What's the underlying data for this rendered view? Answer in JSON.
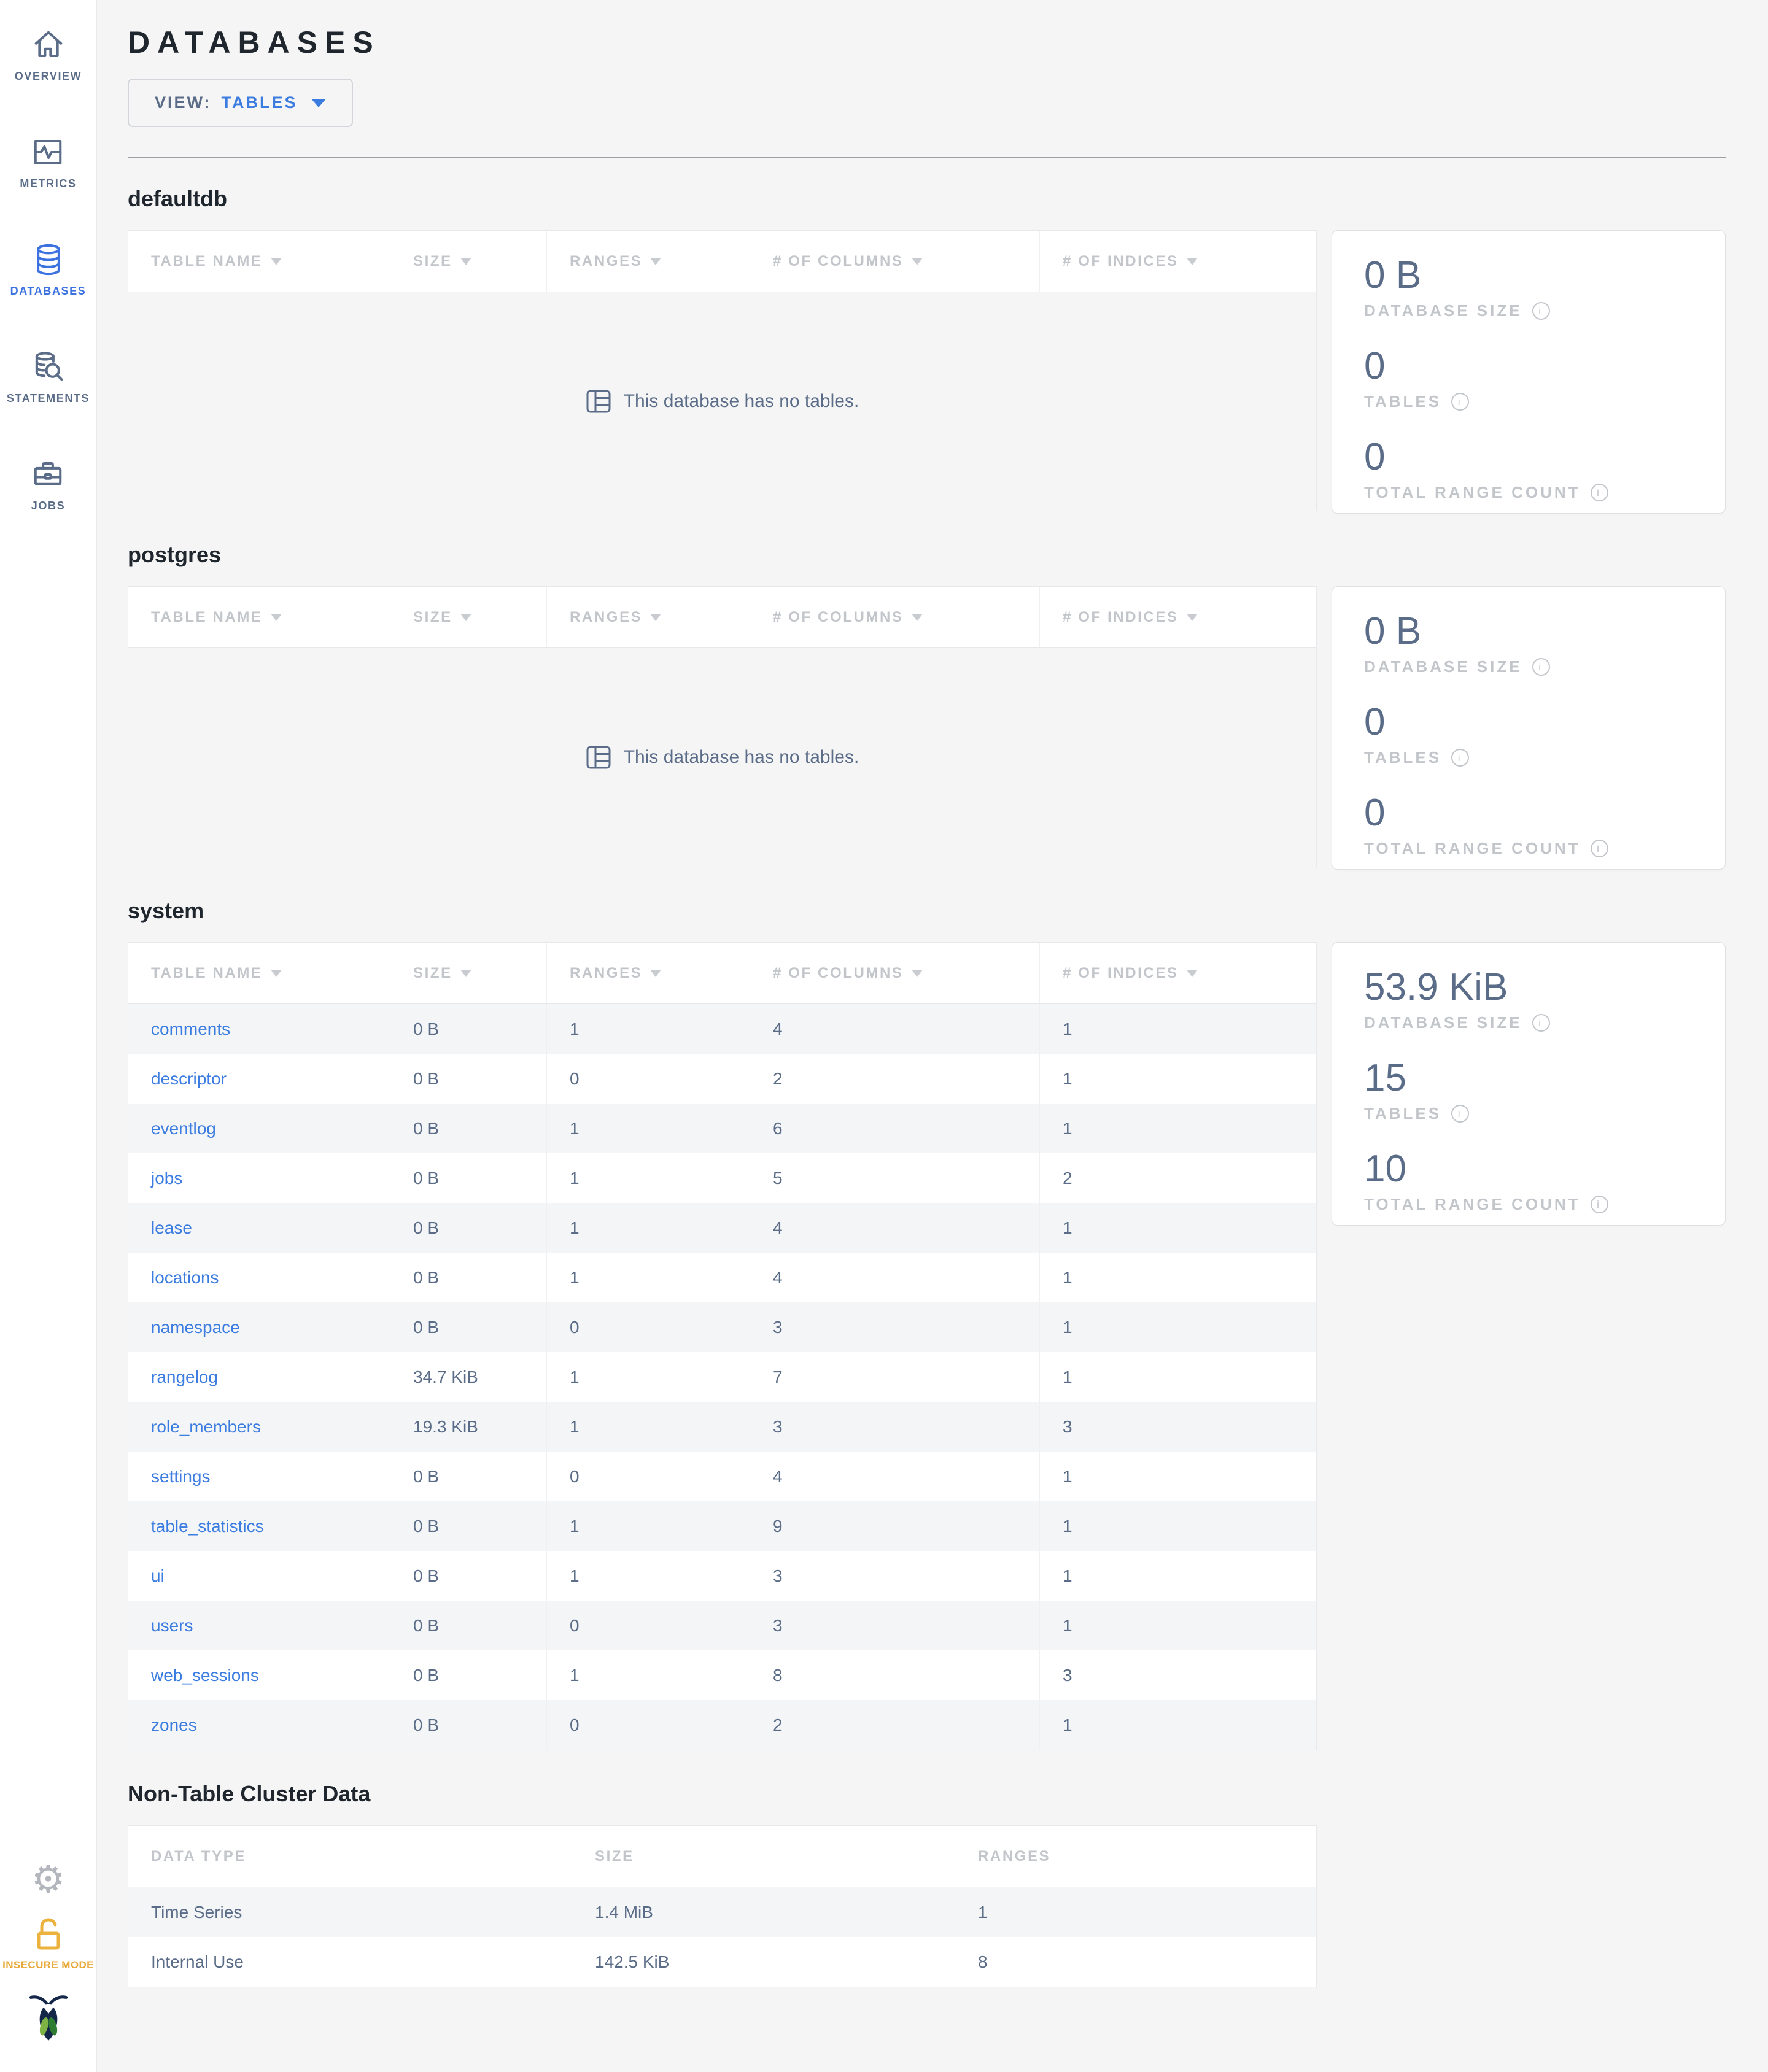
{
  "colors": {
    "page_bg": "#f5f5f5",
    "sidebar_bg": "#ffffff",
    "accent_blue": "#3b7ce0",
    "sidebar_active_blue": "#3b72e0",
    "slate_text": "#5a6c87",
    "muted_label": "#c2c5ca",
    "heading_text": "#20262e",
    "warning_yellow": "#e8a93a",
    "row_stripe": "#f4f5f7"
  },
  "sidebar": {
    "items": [
      {
        "label": "OVERVIEW",
        "icon": "home-icon",
        "active": false
      },
      {
        "label": "METRICS",
        "icon": "metrics-icon",
        "active": false
      },
      {
        "label": "DATABASES",
        "icon": "database-icon",
        "active": true
      },
      {
        "label": "STATEMENTS",
        "icon": "statements-icon",
        "active": false
      },
      {
        "label": "JOBS",
        "icon": "briefcase-icon",
        "active": false
      }
    ],
    "insecure_label": "INSECURE MODE"
  },
  "header": {
    "title": "DATABASES",
    "view_label": "VIEW:",
    "view_value": "TABLES"
  },
  "columns": {
    "table": [
      "TABLE NAME",
      "SIZE",
      "RANGES",
      "# OF COLUMNS",
      "# OF INDICES"
    ],
    "nontable": [
      "DATA TYPE",
      "SIZE",
      "RANGES"
    ]
  },
  "stat_labels": {
    "size": "DATABASE SIZE",
    "tables": "TABLES",
    "ranges": "TOTAL RANGE COUNT"
  },
  "databases": [
    {
      "name": "defaultdb",
      "empty_message": "This database has no tables.",
      "stats": {
        "size": "0 B",
        "tables": "0",
        "ranges": "0"
      }
    },
    {
      "name": "postgres",
      "empty_message": "This database has no tables.",
      "stats": {
        "size": "0 B",
        "tables": "0",
        "ranges": "0"
      }
    },
    {
      "name": "system",
      "rows": [
        [
          "comments",
          "0 B",
          "1",
          "4",
          "1"
        ],
        [
          "descriptor",
          "0 B",
          "0",
          "2",
          "1"
        ],
        [
          "eventlog",
          "0 B",
          "1",
          "6",
          "1"
        ],
        [
          "jobs",
          "0 B",
          "1",
          "5",
          "2"
        ],
        [
          "lease",
          "0 B",
          "1",
          "4",
          "1"
        ],
        [
          "locations",
          "0 B",
          "1",
          "4",
          "1"
        ],
        [
          "namespace",
          "0 B",
          "0",
          "3",
          "1"
        ],
        [
          "rangelog",
          "34.7 KiB",
          "1",
          "7",
          "1"
        ],
        [
          "role_members",
          "19.3 KiB",
          "1",
          "3",
          "3"
        ],
        [
          "settings",
          "0 B",
          "0",
          "4",
          "1"
        ],
        [
          "table_statistics",
          "0 B",
          "1",
          "9",
          "1"
        ],
        [
          "ui",
          "0 B",
          "1",
          "3",
          "1"
        ],
        [
          "users",
          "0 B",
          "0",
          "3",
          "1"
        ],
        [
          "web_sessions",
          "0 B",
          "1",
          "8",
          "3"
        ],
        [
          "zones",
          "0 B",
          "0",
          "2",
          "1"
        ]
      ],
      "stats": {
        "size": "53.9 KiB",
        "tables": "15",
        "ranges": "10"
      }
    }
  ],
  "non_table": {
    "title": "Non-Table Cluster Data",
    "rows": [
      [
        "Time Series",
        "1.4 MiB",
        "1"
      ],
      [
        "Internal Use",
        "142.5 KiB",
        "8"
      ]
    ]
  }
}
